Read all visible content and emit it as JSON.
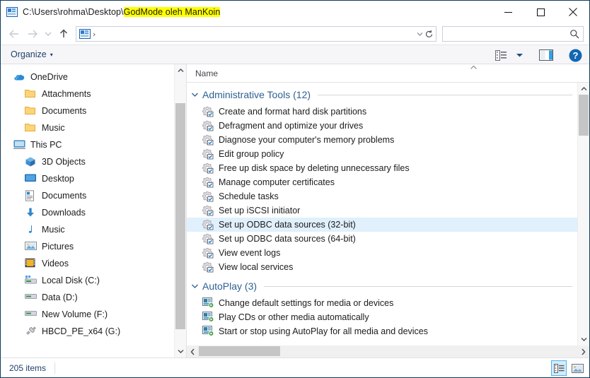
{
  "window": {
    "title_prefix": "C:\\Users\\rohma\\Desktop\\",
    "title_highlight": "GodMode oleh ManKoin",
    "app_icon": "control-panel-icon",
    "caption": {
      "minimize": "—",
      "maximize": "☐",
      "close": "✕"
    }
  },
  "addressbar": {
    "back": "←",
    "forward": "→",
    "recent": "⌄",
    "up": "↑",
    "path_icon": "control-panel-icon",
    "path_separator": "›",
    "path_text": "",
    "dropdown": "⌄",
    "refresh": "↻",
    "search_value": "",
    "search_placeholder": ""
  },
  "commandbar": {
    "organize_label": "Organize",
    "organize_caret": "▾",
    "view_options_icon": "list-view-icon",
    "view_caret": "▾",
    "preview_pane_icon": "preview-pane-icon",
    "help_icon": "help-icon"
  },
  "sidebar": {
    "items": [
      {
        "label": "OneDrive",
        "icon": "onedrive-cloud-icon",
        "level": 0
      },
      {
        "label": "Attachments",
        "icon": "folder-icon",
        "level": 1
      },
      {
        "label": "Documents",
        "icon": "folder-icon",
        "level": 1
      },
      {
        "label": "Music",
        "icon": "folder-icon",
        "level": 1
      },
      {
        "label": "This PC",
        "icon": "this-pc-icon",
        "level": 0
      },
      {
        "label": "3D Objects",
        "icon": "3d-objects-icon",
        "level": 1
      },
      {
        "label": "Desktop",
        "icon": "desktop-icon",
        "level": 1
      },
      {
        "label": "Documents",
        "icon": "documents-icon",
        "level": 1
      },
      {
        "label": "Downloads",
        "icon": "downloads-icon",
        "level": 1
      },
      {
        "label": "Music",
        "icon": "music-note-icon",
        "level": 1
      },
      {
        "label": "Pictures",
        "icon": "pictures-icon",
        "level": 1
      },
      {
        "label": "Videos",
        "icon": "videos-icon",
        "level": 1
      },
      {
        "label": "Local Disk (C:)",
        "icon": "local-disk-icon",
        "level": 1
      },
      {
        "label": "Data (D:)",
        "icon": "drive-icon",
        "level": 1
      },
      {
        "label": "New Volume (F:)",
        "icon": "drive-icon",
        "level": 1
      },
      {
        "label": "HBCD_PE_x64 (G:)",
        "icon": "usb-drive-icon",
        "level": 1
      }
    ],
    "scroll_up": "⌃",
    "scroll_down": "⌄"
  },
  "main": {
    "column_header": "Name",
    "sort_indicator": "⌃",
    "groups": [
      {
        "title": "Administrative Tools (12)",
        "chevron": "⌄",
        "icon": "admin-tool-icon",
        "items": [
          {
            "label": "Create and format hard disk partitions",
            "selected": false
          },
          {
            "label": "Defragment and optimize your drives",
            "selected": false
          },
          {
            "label": "Diagnose your computer's memory problems",
            "selected": false
          },
          {
            "label": "Edit group policy",
            "selected": false
          },
          {
            "label": "Free up disk space by deleting unnecessary files",
            "selected": false
          },
          {
            "label": "Manage computer certificates",
            "selected": false
          },
          {
            "label": "Schedule tasks",
            "selected": false
          },
          {
            "label": "Set up iSCSI initiator",
            "selected": false
          },
          {
            "label": "Set up ODBC data sources (32-bit)",
            "selected": true
          },
          {
            "label": "Set up ODBC data sources (64-bit)",
            "selected": false
          },
          {
            "label": "View event logs",
            "selected": false
          },
          {
            "label": "View local services",
            "selected": false
          }
        ]
      },
      {
        "title": "AutoPlay (3)",
        "chevron": "⌄",
        "icon": "autoplay-icon",
        "items": [
          {
            "label": "Change default settings for media or devices",
            "selected": false
          },
          {
            "label": "Play CDs or other media automatically",
            "selected": false
          },
          {
            "label": "Start or stop using AutoPlay for all media and devices",
            "selected": false
          }
        ]
      }
    ],
    "hscroll_left": "‹",
    "hscroll_right": "›",
    "vscroll_up": "⌃",
    "vscroll_down": "⌄"
  },
  "statusbar": {
    "item_count": "205 items",
    "details_view_icon": "details-view-icon",
    "large_icons_view_icon": "large-icons-view-icon"
  },
  "colors": {
    "highlight_row": "#e0f0fc",
    "group_title": "#2f5f91",
    "accent_blue": "#1f3f6b",
    "title_highlight": "#ffff00",
    "window_border": "#0f3b5e"
  }
}
